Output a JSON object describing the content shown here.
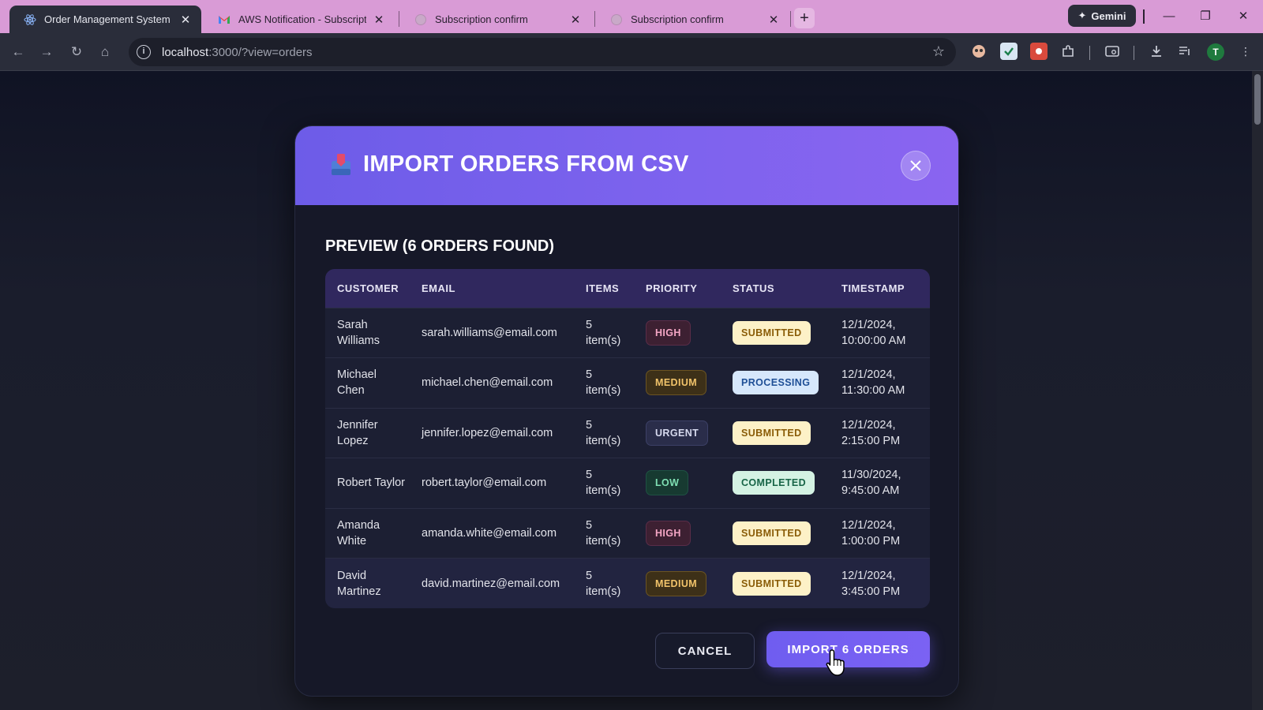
{
  "browser": {
    "tabs": [
      {
        "title": "Order Management System",
        "icon": "react-icon",
        "active": true
      },
      {
        "title": "AWS Notification - Subscription",
        "icon": "gmail-icon",
        "active": false
      },
      {
        "title": "Subscription confirm",
        "icon": "globe-icon",
        "active": false
      },
      {
        "title": "Subscription confirm",
        "icon": "globe-icon",
        "active": false
      }
    ],
    "new_tab_label": "+",
    "gemini_label": "Gemini",
    "url_host": "localhost",
    "url_rest": ":3000/?view=orders",
    "profile_initial": "T",
    "colors": {
      "tabbar": "#d99bd6",
      "toolbar": "#2a2d3a"
    }
  },
  "modal": {
    "title": "IMPORT ORDERS FROM CSV",
    "preview_title": "PREVIEW (6 ORDERS FOUND)",
    "columns": [
      "CUSTOMER",
      "EMAIL",
      "ITEMS",
      "PRIORITY",
      "STATUS",
      "TIMESTAMP"
    ],
    "rows": [
      {
        "customer": "Sarah Williams",
        "email": "sarah.williams@email.com",
        "items": "5 item(s)",
        "priority": "HIGH",
        "priority_class": "p-high",
        "status": "SUBMITTED",
        "status_class": "s-submitted",
        "timestamp": "12/1/2024, 10:00:00 AM"
      },
      {
        "customer": "Michael Chen",
        "email": "michael.chen@email.com",
        "items": "5 item(s)",
        "priority": "MEDIUM",
        "priority_class": "p-medium",
        "status": "PROCESSING",
        "status_class": "s-processing",
        "timestamp": "12/1/2024, 11:30:00 AM"
      },
      {
        "customer": "Jennifer Lopez",
        "email": "jennifer.lopez@email.com",
        "items": "5 item(s)",
        "priority": "URGENT",
        "priority_class": "p-urgent",
        "status": "SUBMITTED",
        "status_class": "s-submitted",
        "timestamp": "12/1/2024, 2:15:00 PM"
      },
      {
        "customer": "Robert Taylor",
        "email": "robert.taylor@email.com",
        "items": "5 item(s)",
        "priority": "LOW",
        "priority_class": "p-low",
        "status": "COMPLETED",
        "status_class": "s-completed",
        "timestamp": "11/30/2024, 9:45:00 AM"
      },
      {
        "customer": "Amanda White",
        "email": "amanda.white@email.com",
        "items": "5 item(s)",
        "priority": "HIGH",
        "priority_class": "p-high",
        "status": "SUBMITTED",
        "status_class": "s-submitted",
        "timestamp": "12/1/2024, 1:00:00 PM"
      },
      {
        "customer": "David Martinez",
        "email": "david.martinez@email.com",
        "items": "5 item(s)",
        "priority": "MEDIUM",
        "priority_class": "p-medium",
        "status": "SUBMITTED",
        "status_class": "s-submitted",
        "timestamp": "12/1/2024, 3:45:00 PM"
      }
    ],
    "cancel_label": "CANCEL",
    "import_label": "IMPORT 6 ORDERS",
    "colors": {
      "accent": "#7b62f3",
      "header_start": "#6d5ce8",
      "header_end": "#8a64f0"
    }
  }
}
